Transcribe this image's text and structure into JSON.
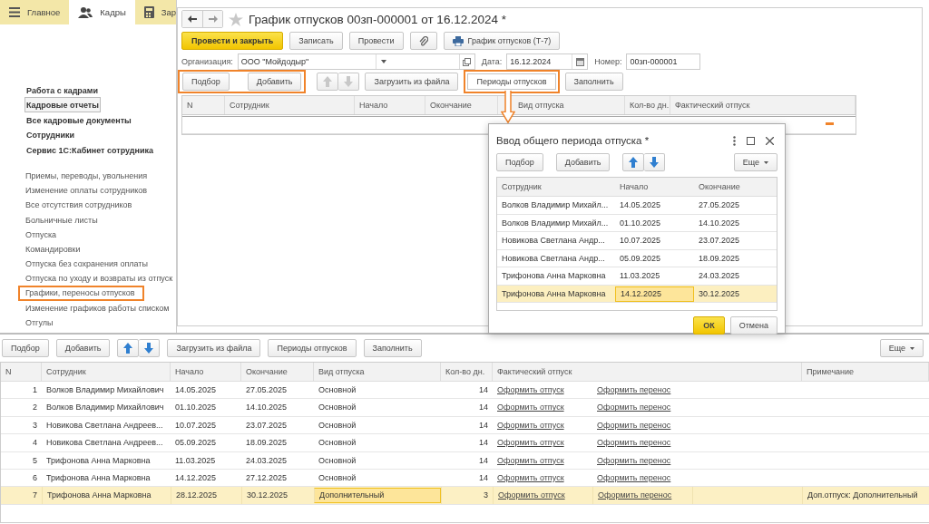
{
  "sections_bar": {
    "tabs": [
      {
        "label": "Главное",
        "selected": false
      },
      {
        "label": "Кадры",
        "selected": true
      },
      {
        "label": "Зар",
        "selected": false
      }
    ]
  },
  "sidebar": {
    "main_items": [
      {
        "label": "Работа с кадрами",
        "selected": false
      },
      {
        "label": "Кадровые отчеты",
        "selected": true
      },
      {
        "label": "Все кадровые документы",
        "selected": false
      },
      {
        "label": "Сотрудники",
        "selected": false
      },
      {
        "label": "Сервис 1С:Кабинет сотрудника",
        "selected": false
      }
    ],
    "items": [
      {
        "label": "Приемы, переводы, увольнения",
        "highlighted": false
      },
      {
        "label": "Изменение оплаты сотрудников",
        "highlighted": false
      },
      {
        "label": "Все отсутствия сотрудников",
        "highlighted": false
      },
      {
        "label": "Больничные листы",
        "highlighted": false
      },
      {
        "label": "Отпуска",
        "highlighted": false
      },
      {
        "label": "Командировки",
        "highlighted": false
      },
      {
        "label": "Отпуска без сохранения оплаты",
        "highlighted": false
      },
      {
        "label": "Отпуска по уходу и возвраты из отпуск",
        "highlighted": false
      },
      {
        "label": "Графики, переносы отпусков",
        "highlighted": true
      },
      {
        "label": "Изменение графиков работы списком",
        "highlighted": false
      },
      {
        "label": "Отгулы",
        "highlighted": false
      }
    ]
  },
  "document": {
    "title": "График отпусков 00зп-000001 от 16.12.2024 *",
    "command_bar": [
      {
        "kind": "primary",
        "label": "Провести и закрыть"
      },
      {
        "kind": "button",
        "label": "Записать"
      },
      {
        "kind": "button",
        "label": "Провести"
      },
      {
        "kind": "attach"
      },
      {
        "kind": "print",
        "label": "График отпусков (Т-7)"
      }
    ],
    "organization": {
      "label": "Организация:",
      "value": "ООО \"Мойдодыр\""
    },
    "date": {
      "label": "Дата:",
      "value": "16.12.2024"
    },
    "number": {
      "label": "Номер:",
      "value": "00зп-000001"
    },
    "table_toolbar": [
      {
        "kind": "group",
        "highlighted": true,
        "buttons": [
          "Подбор",
          "Добавить"
        ]
      },
      {
        "kind": "arrows",
        "disabled": true
      },
      {
        "kind": "button",
        "label": "Загрузить из файла",
        "highlighted": false
      },
      {
        "kind": "button",
        "label": "Периоды отпусков",
        "highlighted": true
      },
      {
        "kind": "button",
        "label": "Заполнить",
        "highlighted": false
      }
    ],
    "table": {
      "columns": [
        "N",
        "Сотрудник",
        "Начало",
        "Окончание",
        "Вид отпуска",
        "Кол-во дн.",
        "Фактический отпуск"
      ]
    }
  },
  "dialog": {
    "title": "Ввод общего периода отпуска *",
    "toolbar": {
      "buttons": [
        "Подбор",
        "Добавить"
      ],
      "more": "Еще"
    },
    "columns": [
      "Сотрудник",
      "Начало",
      "Окончание"
    ],
    "rows": [
      {
        "employee": "Волков Владимир Михайл...",
        "start": "14.05.2025",
        "end": "27.05.2025",
        "selected": false
      },
      {
        "employee": "Волков Владимир Михайл...",
        "start": "01.10.2025",
        "end": "14.10.2025",
        "selected": false
      },
      {
        "employee": "Новикова Светлана Андр...",
        "start": "10.07.2025",
        "end": "23.07.2025",
        "selected": false
      },
      {
        "employee": "Новикова Светлана Андр...",
        "start": "05.09.2025",
        "end": "18.09.2025",
        "selected": false
      },
      {
        "employee": "Трифонова Анна Марковна",
        "start": "11.03.2025",
        "end": "24.03.2025",
        "selected": false
      },
      {
        "employee": "Трифонова Анна Марковна",
        "start": "14.12.2025",
        "end": "30.12.2025",
        "selected": true
      }
    ],
    "ok": "ОК",
    "cancel": "Отмена"
  },
  "result": {
    "toolbar": [
      {
        "kind": "button",
        "label": "Подбор"
      },
      {
        "kind": "button",
        "label": "Добавить"
      },
      {
        "kind": "arrows",
        "disabled": false
      },
      {
        "kind": "button",
        "label": "Загрузить из файла"
      },
      {
        "kind": "button",
        "label": "Периоды отпусков"
      },
      {
        "kind": "button",
        "label": "Заполнить"
      }
    ],
    "more": "Еще",
    "columns": [
      "N",
      "Сотрудник",
      "Начало",
      "Окончание",
      "Вид отпуска",
      "Кол-во дн.",
      "Фактический отпуск",
      "Примечание"
    ],
    "rows": [
      {
        "n": "1",
        "employee": "Волков Владимир Михайлович",
        "start": "14.05.2025",
        "end": "27.05.2025",
        "type": "Основной",
        "days": "14",
        "link1": "Оформить отпуск",
        "link2": "Оформить перенос",
        "selected": false
      },
      {
        "n": "2",
        "employee": "Волков Владимир Михайлович",
        "start": "01.10.2025",
        "end": "14.10.2025",
        "type": "Основной",
        "days": "14",
        "link1": "Оформить отпуск",
        "link2": "Оформить перенос",
        "selected": false
      },
      {
        "n": "3",
        "employee": "Новикова Светлана Андреев...",
        "start": "10.07.2025",
        "end": "23.07.2025",
        "type": "Основной",
        "days": "14",
        "link1": "Оформить отпуск",
        "link2": "Оформить перенос",
        "selected": false
      },
      {
        "n": "4",
        "employee": "Новикова Светлана Андреев...",
        "start": "05.09.2025",
        "end": "18.09.2025",
        "type": "Основной",
        "days": "14",
        "link1": "Оформить отпуск",
        "link2": "Оформить перенос",
        "selected": false
      },
      {
        "n": "5",
        "employee": "Трифонова Анна Марковна",
        "start": "11.03.2025",
        "end": "24.03.2025",
        "type": "Основной",
        "days": "14",
        "link1": "Оформить отпуск",
        "link2": "Оформить перенос",
        "selected": false
      },
      {
        "n": "6",
        "employee": "Трифонова Анна Марковна",
        "start": "14.12.2025",
        "end": "27.12.2025",
        "type": "Основной",
        "days": "14",
        "link1": "Оформить отпуск",
        "link2": "Оформить перенос",
        "selected": false
      },
      {
        "n": "7",
        "employee": "Трифонова Анна Марковна",
        "start": "28.12.2025",
        "end": "30.12.2025",
        "type": "Дополнительный",
        "days": "3",
        "link1": "Оформить отпуск",
        "link2": "Оформить перенос",
        "note": "Доп.отпуск: Дополнительный",
        "selected": true
      }
    ]
  }
}
